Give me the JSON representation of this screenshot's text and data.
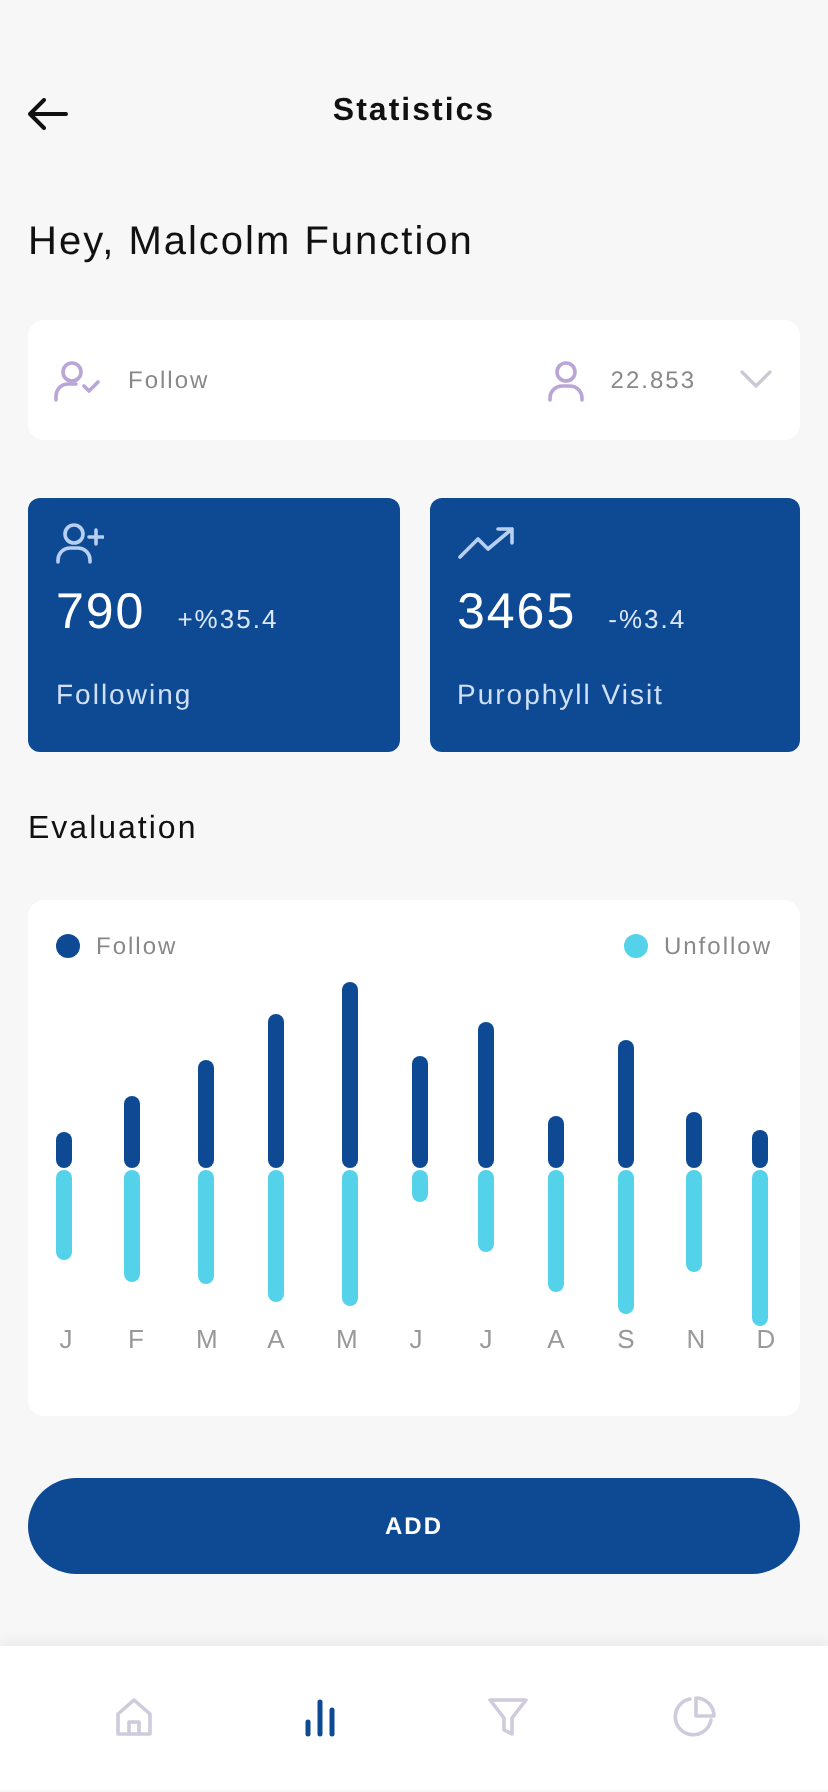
{
  "header": {
    "title": "Statistics"
  },
  "greeting": "Hey, Malcolm Function",
  "selector": {
    "label": "Follow",
    "value": "22.853"
  },
  "stats": [
    {
      "kind": "following",
      "value": "790",
      "change": "+%35.4",
      "label": "Following"
    },
    {
      "kind": "visit",
      "value": "3465",
      "change": "-%3.4",
      "label": "Purophyll Visit"
    }
  ],
  "evaluation": {
    "title": "Evaluation",
    "legend": [
      {
        "label": "Follow",
        "color": "#0e4a94"
      },
      {
        "label": "Unfollow",
        "color": "#54d2ea"
      }
    ],
    "months": [
      "J",
      "F",
      "M",
      "A",
      "M",
      "J",
      "J",
      "A",
      "S",
      "N",
      "D"
    ]
  },
  "button": "ADD",
  "nav": [
    {
      "kind": "home",
      "selected": false
    },
    {
      "kind": "stats",
      "selected": true
    },
    {
      "kind": "filter",
      "selected": false
    },
    {
      "kind": "pie",
      "selected": false
    }
  ]
}
